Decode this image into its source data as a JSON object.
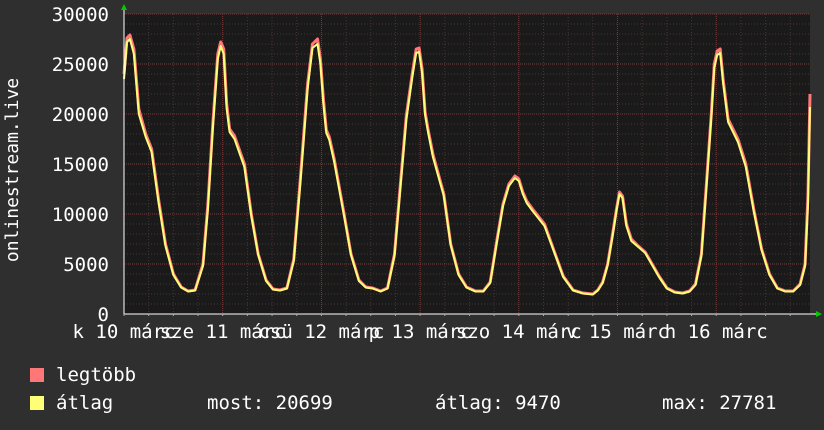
{
  "chart_data": {
    "type": "line",
    "ylabel": "onlinestream.live",
    "ylim": [
      0,
      30000
    ],
    "yticks": [
      0,
      5000,
      10000,
      15000,
      20000,
      25000,
      30000
    ],
    "xlim": [
      0,
      6.95
    ],
    "x_tick_labels": [
      {
        "x": 0,
        "label": "k 10 márc"
      },
      {
        "x": 1,
        "label": "sze 11 márc"
      },
      {
        "x": 2,
        "label": "csü 12 márc"
      },
      {
        "x": 3,
        "label": "p 13 márc"
      },
      {
        "x": 4,
        "label": "szo 14 márc"
      },
      {
        "x": 5,
        "label": "v 15 márc"
      },
      {
        "x": 6,
        "label": "h 16 márc"
      }
    ],
    "grid": true,
    "series": [
      {
        "name": "legtöbb",
        "color": "#ff7777",
        "x": [
          0,
          0.03,
          0.06,
          0.1,
          0.15,
          0.22,
          0.28,
          0.35,
          0.42,
          0.5,
          0.58,
          0.65,
          0.72,
          0.8,
          0.85,
          0.9,
          0.95,
          0.98,
          1.01,
          1.04,
          1.07,
          1.12,
          1.22,
          1.29,
          1.36,
          1.44,
          1.51,
          1.58,
          1.65,
          1.72,
          1.79,
          1.86,
          1.91,
          1.96,
          1.99,
          2.02,
          2.05,
          2.08,
          2.13,
          2.23,
          2.3,
          2.38,
          2.45,
          2.52,
          2.6,
          2.67,
          2.74,
          2.8,
          2.86,
          2.92,
          2.96,
          2.99,
          3.02,
          3.05,
          3.08,
          3.13,
          3.24,
          3.31,
          3.39,
          3.47,
          3.56,
          3.64,
          3.71,
          3.78,
          3.84,
          3.9,
          3.96,
          4.0,
          4.04,
          4.08,
          4.14,
          4.26,
          4.35,
          4.45,
          4.55,
          4.65,
          4.75,
          4.8,
          4.85,
          4.9,
          4.95,
          4.99,
          5.02,
          5.05,
          5.09,
          5.14,
          5.21,
          5.28,
          5.35,
          5.42,
          5.5,
          5.58,
          5.66,
          5.73,
          5.79,
          5.85,
          5.9,
          5.95,
          5.98,
          6.01,
          6.04,
          6.07,
          6.12,
          6.22,
          6.3,
          6.38,
          6.46,
          6.54,
          6.62,
          6.7,
          6.78,
          6.85,
          6.9,
          6.93,
          6.95
        ],
        "values": [
          24000,
          27600,
          27900,
          26500,
          20500,
          18000,
          16500,
          11500,
          7000,
          4000,
          2700,
          2300,
          2400,
          5000,
          11000,
          19000,
          26000,
          27200,
          26500,
          21000,
          18500,
          17800,
          15000,
          10000,
          6000,
          3400,
          2500,
          2400,
          2600,
          5500,
          14000,
          23000,
          27000,
          27500,
          25500,
          21500,
          18400,
          17700,
          15500,
          10000,
          6000,
          3400,
          2700,
          2600,
          2300,
          2600,
          6000,
          13000,
          19800,
          24000,
          26500,
          26600,
          24500,
          20200,
          18500,
          16000,
          12000,
          7000,
          4000,
          2700,
          2300,
          2300,
          3200,
          7500,
          11000,
          13000,
          13800,
          13500,
          12200,
          11300,
          10500,
          9000,
          6500,
          3800,
          2400,
          2100,
          2000,
          2400,
          3200,
          5000,
          8000,
          10500,
          12200,
          11800,
          9000,
          7500,
          6800,
          6200,
          5000,
          3800,
          2600,
          2200,
          2100,
          2300,
          3000,
          6000,
          13000,
          20000,
          25000,
          26300,
          26500,
          23500,
          19500,
          17500,
          15000,
          10500,
          6500,
          4000,
          2600,
          2300,
          2300,
          3000,
          5000,
          12000,
          22000
        ]
      },
      {
        "name": "átlag",
        "color": "#ffff77",
        "x": [
          0,
          0.03,
          0.06,
          0.1,
          0.15,
          0.22,
          0.28,
          0.35,
          0.42,
          0.5,
          0.58,
          0.65,
          0.72,
          0.8,
          0.85,
          0.9,
          0.95,
          0.98,
          1.01,
          1.04,
          1.07,
          1.12,
          1.22,
          1.29,
          1.36,
          1.44,
          1.51,
          1.58,
          1.65,
          1.72,
          1.79,
          1.86,
          1.91,
          1.96,
          1.99,
          2.02,
          2.05,
          2.08,
          2.13,
          2.23,
          2.3,
          2.38,
          2.45,
          2.52,
          2.6,
          2.67,
          2.74,
          2.8,
          2.86,
          2.92,
          2.96,
          2.99,
          3.02,
          3.05,
          3.08,
          3.13,
          3.24,
          3.31,
          3.39,
          3.47,
          3.56,
          3.64,
          3.71,
          3.78,
          3.84,
          3.9,
          3.96,
          4.0,
          4.04,
          4.08,
          4.14,
          4.26,
          4.35,
          4.45,
          4.55,
          4.65,
          4.75,
          4.8,
          4.85,
          4.9,
          4.95,
          4.99,
          5.02,
          5.05,
          5.09,
          5.14,
          5.21,
          5.28,
          5.35,
          5.42,
          5.5,
          5.58,
          5.66,
          5.73,
          5.79,
          5.85,
          5.9,
          5.95,
          5.98,
          6.01,
          6.04,
          6.07,
          6.12,
          6.22,
          6.3,
          6.38,
          6.46,
          6.54,
          6.62,
          6.7,
          6.78,
          6.85,
          6.9,
          6.93,
          6.95
        ],
        "values": [
          23500,
          27200,
          27500,
          26000,
          20000,
          17700,
          16200,
          11200,
          6800,
          3900,
          2650,
          2250,
          2350,
          4800,
          10500,
          18500,
          25500,
          26800,
          26000,
          20500,
          18200,
          17500,
          14700,
          9800,
          5900,
          3300,
          2450,
          2350,
          2550,
          5300,
          13500,
          22500,
          26600,
          27000,
          25000,
          21000,
          18100,
          17400,
          15200,
          9800,
          5900,
          3300,
          2650,
          2550,
          2250,
          2550,
          5800,
          12600,
          19400,
          23600,
          26100,
          26200,
          24100,
          19900,
          18200,
          15700,
          11800,
          6900,
          3900,
          2650,
          2250,
          2250,
          3100,
          7300,
          10800,
          12800,
          13600,
          13300,
          12000,
          11100,
          10300,
          8800,
          6400,
          3700,
          2350,
          2050,
          1950,
          2350,
          3100,
          4900,
          7800,
          10300,
          12000,
          11600,
          8800,
          7300,
          6700,
          6100,
          4900,
          3700,
          2550,
          2150,
          2050,
          2250,
          2900,
          5800,
          12600,
          19600,
          24600,
          25900,
          26100,
          23100,
          19200,
          17200,
          14700,
          10300,
          6400,
          3900,
          2550,
          2250,
          2250,
          2900,
          4800,
          11000,
          20700
        ]
      }
    ],
    "stats": {
      "now_label": "most:",
      "now_value": "20699",
      "avg_label": "átlag:",
      "avg_value": "9470",
      "max_label": "max:",
      "max_value": "27781"
    }
  },
  "colors": {
    "background": "#2f2f2f",
    "plot_background": "#1a1a1a",
    "grid_minor": "#4a3434",
    "grid_major": "#7a3c3c",
    "axis_arrow": "#00cc00"
  }
}
